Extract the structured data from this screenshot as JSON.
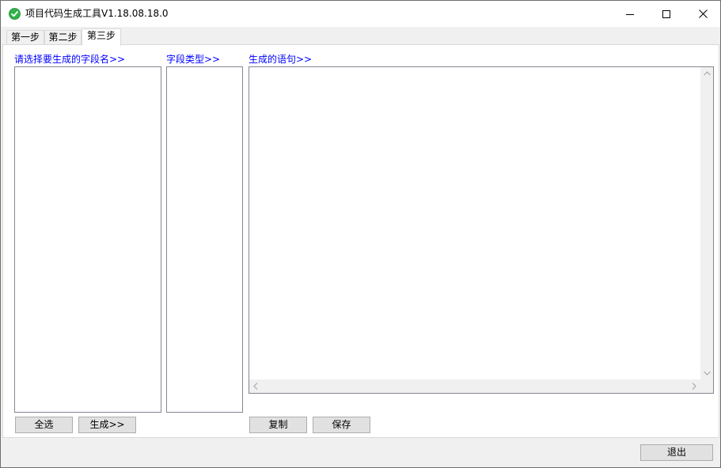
{
  "window": {
    "title": "项目代码生成工具V1.18.08.18.0",
    "accent_icon_color": "#2fb34a"
  },
  "tabs": [
    {
      "label": "第一步",
      "active": false
    },
    {
      "label": "第二步",
      "active": false
    },
    {
      "label": "第三步",
      "active": true
    }
  ],
  "step3": {
    "fields_label": "请选择要生成的字段名>>",
    "types_label": "字段类型>>",
    "statement_label": "生成的语句>>",
    "select_all_button": "全选",
    "generate_button": "生成>>",
    "copy_button": "复制",
    "save_button": "保存"
  },
  "footer": {
    "exit_button": "退出"
  },
  "colors": {
    "label_blue": "#0000ff",
    "button_face": "#e1e1e1"
  }
}
